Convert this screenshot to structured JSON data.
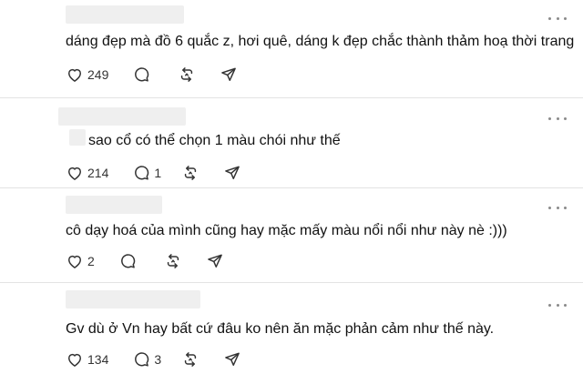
{
  "comments": [
    {
      "text": "dáng đẹp mà đồ 6 quắc z, hơi quê, dáng k đẹp chắc thành thảm hoạ thời trang",
      "likes": "249",
      "replies": ""
    },
    {
      "text": "sao cổ có thể chọn 1 màu chói như thế",
      "likes": "214",
      "replies": "1"
    },
    {
      "text": "cô dạy hoá của mình cũng hay mặc mấy màu nổi nổi như này nè :)))",
      "likes": "2",
      "replies": ""
    },
    {
      "text": "Gv dù ở Vn hay bất cứ đâu ko nên ăn mặc phản cảm như thế này.",
      "likes": "134",
      "replies": "3"
    }
  ],
  "icons": {
    "like": "heart-icon",
    "reply": "comment-icon",
    "repost": "repost-icon",
    "share": "send-icon",
    "more": "more-icon"
  },
  "colors": {
    "text": "#111111",
    "icon": "#333333",
    "divider": "#e3e3e3",
    "redacted": "#efefef"
  }
}
